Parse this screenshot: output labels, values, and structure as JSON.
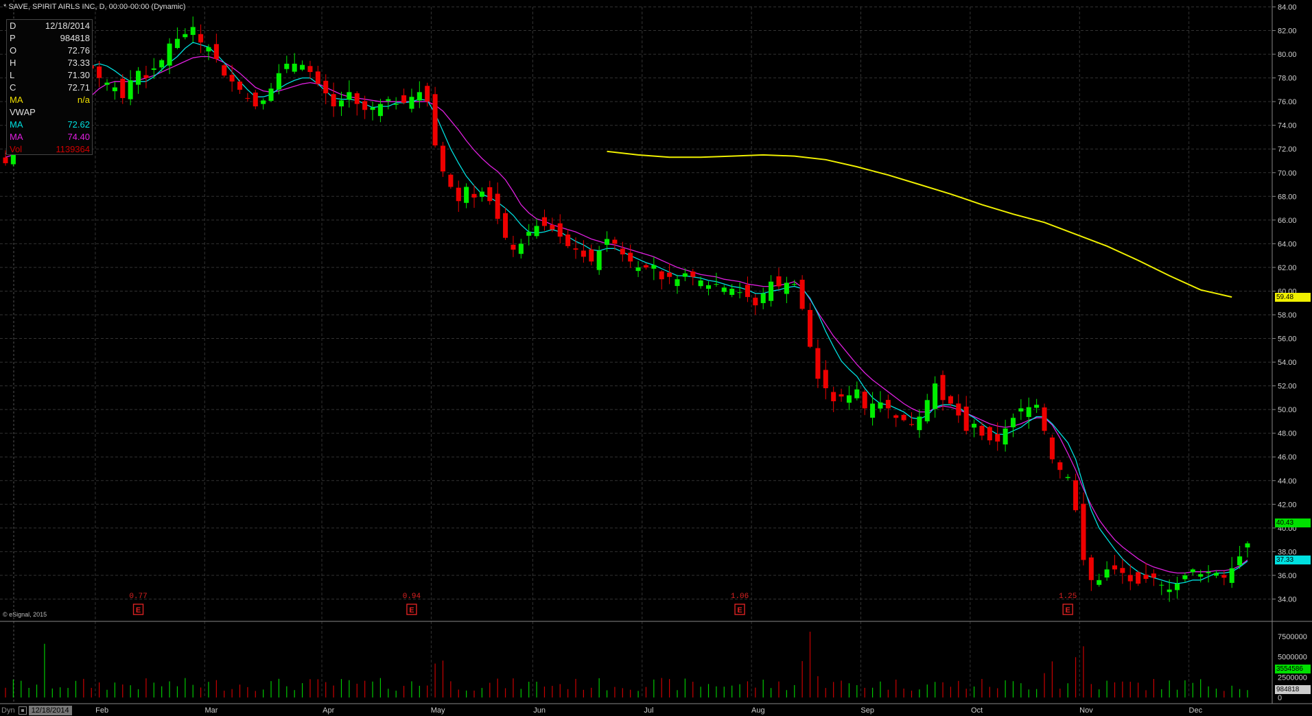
{
  "header": {
    "title": "* SAVE, SPIRIT AIRLS INC, D, 00:00-00:00 (Dynamic)"
  },
  "info_panel": {
    "rows": [
      {
        "label": "D",
        "value": "12/18/2014",
        "color": "#e0e0e0"
      },
      {
        "label": "P",
        "value": "984818",
        "color": "#e0e0e0"
      },
      {
        "label": "O",
        "value": "72.76",
        "color": "#e0e0e0"
      },
      {
        "label": "H",
        "value": "73.33",
        "color": "#e0e0e0"
      },
      {
        "label": "L",
        "value": "71.30",
        "color": "#e0e0e0"
      },
      {
        "label": "C",
        "value": "72.71",
        "color": "#e0e0e0"
      },
      {
        "label": "MA",
        "value": "n/a",
        "color": "#f0e000"
      },
      {
        "label": "VWAP",
        "value": "",
        "color": "#e0e0e0"
      },
      {
        "label": "MA",
        "value": "72.62",
        "color": "#00e0e0"
      },
      {
        "label": "MA",
        "value": "74.40",
        "color": "#e020e0"
      },
      {
        "label": "Vol",
        "value": "1139364",
        "color": "#d00000"
      }
    ]
  },
  "watermark": "© eSignal, 2015",
  "bottom_bar": {
    "mode_label": "Dyn",
    "date": "12/18/2014"
  },
  "price_tags": [
    {
      "value": "59.48",
      "bg": "#f0f000"
    },
    {
      "value": "40.43",
      "bg": "#00e000"
    },
    {
      "value": "37.33",
      "bg": "#00e0e0"
    }
  ],
  "volume_tags": [
    {
      "value": "3554586",
      "bg": "#00e000"
    },
    {
      "value": "984818",
      "bg": "#cccccc"
    }
  ],
  "colors": {
    "up": "#00ee00",
    "down": "#ee0000",
    "ma_fast": "#00e0e0",
    "ma_slow": "#e020e0",
    "ma_long": "#f0f000",
    "grid": "#333333",
    "earnings": "#dd2222"
  },
  "chart_data": {
    "type": "candlestick",
    "y_axis": {
      "min": 32,
      "max": 84,
      "step": 2,
      "ticks": [
        "34.00",
        "36.00",
        "38.00",
        "40.00",
        "42.00",
        "44.00",
        "46.00",
        "48.00",
        "50.00",
        "52.00",
        "54.00",
        "56.00",
        "58.00",
        "60.00",
        "62.00",
        "64.00",
        "66.00",
        "68.00",
        "70.00",
        "72.00",
        "74.00",
        "76.00",
        "78.00",
        "80.00",
        "82.00",
        "84.00"
      ]
    },
    "volume_axis": {
      "ticks": [
        "0",
        "2500000",
        "5000000",
        "7500000"
      ],
      "max": 9000000
    },
    "months": [
      "Feb",
      "Mar",
      "Apr",
      "May",
      "Jun",
      "Jul",
      "Aug",
      "Sep",
      "Oct",
      "Nov",
      "Dec"
    ],
    "month_start_index": [
      12,
      26,
      41,
      55,
      68,
      82,
      96,
      110,
      124,
      138,
      152
    ],
    "earnings": [
      {
        "index": 17,
        "value": "0.77"
      },
      {
        "index": 52,
        "value": "0.94"
      },
      {
        "index": 94,
        "value": "1.06"
      },
      {
        "index": 136,
        "value": "1.25"
      }
    ],
    "grid": true,
    "close": [
      70.8,
      71.9,
      72.7,
      73.2,
      73.9,
      75.8,
      76.7,
      77.6,
      78.9,
      80.0,
      79.5,
      78.8,
      78.0,
      77.6,
      77.2,
      76.3,
      77.8,
      78.6,
      78.0,
      78.8,
      79.5,
      80.9,
      81.3,
      81.7,
      82.3,
      81.0,
      80.6,
      79.6,
      78.2,
      77.7,
      77.0,
      76.3,
      75.6,
      76.1,
      77.1,
      78.4,
      79.2,
      79.2,
      79.1,
      78.5,
      77.5,
      76.7,
      75.6,
      76.1,
      76.8,
      75.8,
      75.3,
      75.5,
      75.8,
      76.2,
      75.8,
      75.9,
      76.4,
      76.8,
      76.0,
      72.3,
      70.1,
      68.8,
      67.6,
      68.8,
      67.9,
      68.4,
      67.6,
      66.1,
      64.5,
      63.5,
      64.0,
      65.0,
      65.5,
      65.5,
      65.2,
      64.6,
      63.8,
      63.5,
      62.9,
      62.5,
      63.4,
      64.4,
      64.0,
      63.1,
      62.5,
      62.0,
      62.0,
      62.2,
      61.0,
      61.2,
      61.0,
      61.5,
      61.2,
      60.9,
      60.5,
      60.6,
      60.3,
      60.2,
      59.9,
      59.5,
      58.8,
      59.8,
      60.8,
      60.4,
      60.7,
      60.6,
      58.5,
      55.3,
      52.6,
      51.8,
      50.7,
      51.1,
      51.2,
      51.7,
      50.1,
      50.5,
      50.6,
      50.1,
      49.3,
      49.1,
      48.7,
      49.4,
      50.8,
      52.2,
      50.8,
      50.5,
      49.5,
      48.2,
      48.8,
      47.8,
      47.4,
      47.3,
      48.4,
      49.3,
      50.1,
      50.2,
      50.4,
      48.2,
      45.8,
      44.9,
      44.3,
      41.5,
      37.3,
      35.6,
      35.6,
      36.5,
      36.5,
      36.2,
      35.5,
      35.3,
      35.7,
      35.8,
      35.2,
      34.8,
      35.3,
      36.0,
      36.5,
      36.1,
      36.3,
      36.2,
      35.8,
      36.6,
      37.6,
      38.7
    ],
    "ma_fast": [
      71.6,
      72.0,
      72.6,
      73.3,
      74.1,
      75.0,
      75.8,
      76.6,
      77.4,
      78.1,
      78.7,
      79.0,
      79.2,
      79.0,
      78.6,
      78.1,
      77.7,
      77.7,
      77.7,
      78.1,
      78.7,
      79.3,
      79.8,
      80.5,
      81.0,
      80.8,
      80.6,
      80.0,
      79.3,
      78.5,
      77.7,
      77.0,
      76.4,
      76.4,
      76.6,
      77.1,
      77.5,
      77.8,
      78.0,
      78.0,
      77.5,
      76.9,
      76.3,
      76.2,
      76.2,
      76.1,
      75.8,
      75.5,
      75.6,
      75.6,
      75.9,
      75.9,
      76.0,
      76.2,
      76.1,
      75.0,
      73.5,
      72.0,
      70.8,
      69.7,
      68.9,
      68.2,
      67.9,
      67.5,
      67.0,
      66.4,
      65.6,
      65.0,
      64.9,
      65.0,
      65.2,
      65.0,
      64.6,
      64.2,
      63.9,
      63.5,
      63.4,
      63.6,
      63.6,
      63.3,
      63.0,
      62.7,
      62.4,
      62.2,
      61.9,
      61.6,
      61.3,
      61.3,
      61.2,
      61.1,
      60.9,
      60.8,
      60.6,
      60.4,
      60.3,
      60.1,
      59.8,
      59.8,
      60.0,
      60.1,
      60.3,
      60.4,
      60.2,
      59.4,
      58.1,
      56.6,
      55.3,
      54.1,
      53.4,
      52.8,
      51.8,
      51.0,
      50.5,
      50.4,
      50.1,
      49.8,
      49.3,
      49.2,
      49.5,
      50.2,
      50.4,
      50.4,
      50.2,
      49.7,
      49.3,
      48.8,
      48.3,
      47.9,
      47.9,
      48.2,
      48.5,
      49.0,
      49.4,
      49.4,
      48.8,
      48.0,
      47.2,
      45.8,
      43.6,
      41.5,
      40.0,
      39.1,
      38.2,
      37.4,
      36.8,
      36.3,
      36.0,
      35.8,
      35.6,
      35.4,
      35.3,
      35.4,
      35.6,
      35.6,
      35.9,
      36.2,
      36.2,
      36.3,
      36.7,
      37.2
    ],
    "ma_slow": [
      71.3,
      71.5,
      71.8,
      72.2,
      72.6,
      73.1,
      73.6,
      74.2,
      74.8,
      75.4,
      75.9,
      76.5,
      77.1,
      77.5,
      77.7,
      77.7,
      77.7,
      77.8,
      78.0,
      78.2,
      78.5,
      78.8,
      79.1,
      79.4,
      79.7,
      79.8,
      79.8,
      79.6,
      79.3,
      78.9,
      78.4,
      77.8,
      77.2,
      76.9,
      76.8,
      76.9,
      77.1,
      77.3,
      77.5,
      77.6,
      77.5,
      77.2,
      76.9,
      76.6,
      76.4,
      76.3,
      76.2,
      76.1,
      76.0,
      76.0,
      76.0,
      76.0,
      76.0,
      76.0,
      76.0,
      75.7,
      75.2,
      74.4,
      73.6,
      72.7,
      71.9,
      71.2,
      70.6,
      70.1,
      69.4,
      68.4,
      67.3,
      66.6,
      66.1,
      65.9,
      65.6,
      65.4,
      65.2,
      65.0,
      64.7,
      64.4,
      64.2,
      64.0,
      63.9,
      63.7,
      63.5,
      63.3,
      63.1,
      62.9,
      62.6,
      62.3,
      62.0,
      61.8,
      61.6,
      61.4,
      61.3,
      61.2,
      61.0,
      60.9,
      60.8,
      60.6,
      60.5,
      60.4,
      60.4,
      60.5,
      60.6,
      60.8,
      60.3,
      59.3,
      58.2,
      57.2,
      56.2,
      55.4,
      54.6,
      53.8,
      53.1,
      52.5,
      52.0,
      51.5,
      51.0,
      50.5,
      50.1,
      49.8,
      49.8,
      50.1,
      50.3,
      50.2,
      50.0,
      49.7,
      49.4,
      49.1,
      48.8,
      48.6,
      48.5,
      48.6,
      48.8,
      49.1,
      49.3,
      49.3,
      48.7,
      47.6,
      46.3,
      44.9,
      43.3,
      41.9,
      40.7,
      39.8,
      39.0,
      38.4,
      37.9,
      37.4,
      37.0,
      36.7,
      36.5,
      36.3,
      36.2,
      36.2,
      36.3,
      36.3,
      36.3,
      36.4,
      36.4,
      36.5,
      36.8,
      37.3
    ],
    "ma_long": {
      "start_index": 77,
      "values": [
        71.8,
        71.5,
        71.3,
        71.3,
        71.4,
        71.5,
        71.4,
        71.1,
        70.5,
        69.8,
        69.0,
        68.2,
        67.3,
        66.5,
        65.8,
        64.8,
        63.8,
        62.6,
        61.3,
        60.1,
        59.5
      ]
    }
  }
}
